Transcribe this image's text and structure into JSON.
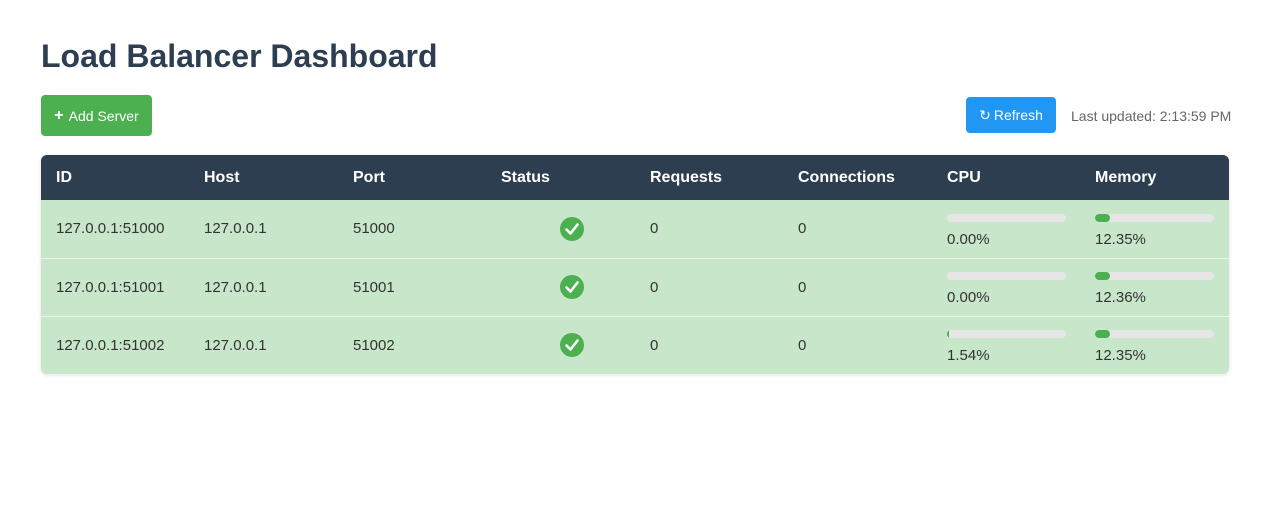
{
  "page": {
    "title": "Load Balancer Dashboard"
  },
  "toolbar": {
    "add_icon": "plus-icon",
    "add_label": "Add Server",
    "refresh_icon": "refresh-icon",
    "refresh_label": "Refresh",
    "last_updated": "Last updated: 2:13:59 PM"
  },
  "colors": {
    "header_bg": "#2c3e50",
    "add_button": "#4caf50",
    "refresh_button": "#2196f3",
    "row_healthy_bg": "#c8e6c9",
    "meter_fill": "#4caf50",
    "meter_track": "#e6e6e6"
  },
  "table": {
    "headers": [
      "ID",
      "Host",
      "Port",
      "Status",
      "Requests",
      "Connections",
      "CPU",
      "Memory"
    ],
    "rows": [
      {
        "id": "127.0.0.1:51000",
        "host": "127.0.0.1",
        "port": "51000",
        "status_icon": "check-circle-icon",
        "requests": "0",
        "connections": "0",
        "cpu": "0.00%",
        "cpu_level": 0.0,
        "memory": "12.35%",
        "memory_level": 12.35
      },
      {
        "id": "127.0.0.1:51001",
        "host": "127.0.0.1",
        "port": "51001",
        "status_icon": "check-circle-icon",
        "requests": "0",
        "connections": "0",
        "cpu": "0.00%",
        "cpu_level": 0.0,
        "memory": "12.36%",
        "memory_level": 12.36
      },
      {
        "id": "127.0.0.1:51002",
        "host": "127.0.0.1",
        "port": "51002",
        "status_icon": "check-circle-icon",
        "requests": "0",
        "connections": "0",
        "cpu": "1.54%",
        "cpu_level": 1.54,
        "memory": "12.35%",
        "memory_level": 12.35
      }
    ]
  }
}
